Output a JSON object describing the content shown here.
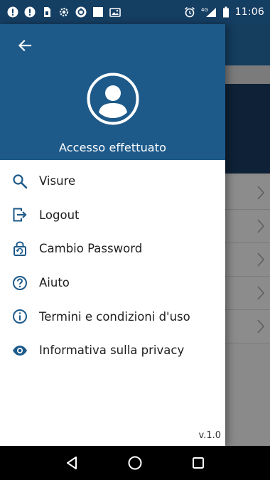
{
  "status_bar": {
    "network_label": "4G",
    "time": "11:06",
    "icons": [
      "alert-icon",
      "alert-icon",
      "sim-icon",
      "settings-icon",
      "sync-icon",
      "app-icon",
      "photo-icon",
      "alarm-icon",
      "signal-icon",
      "battery-icon"
    ]
  },
  "drawer": {
    "back_icon": "arrow-left-icon",
    "avatar_icon": "account-circle-icon",
    "status": "Accesso effettuato",
    "items": [
      {
        "label": "Visure",
        "icon": "search-icon"
      },
      {
        "label": "Logout",
        "icon": "logout-icon"
      },
      {
        "label": "Cambio Password",
        "icon": "lock-icon"
      },
      {
        "label": "Aiuto",
        "icon": "help-icon"
      },
      {
        "label": "Termini e condizioni d'uso",
        "icon": "info-icon"
      },
      {
        "label": "Informativa sulla privacy",
        "icon": "eye-icon"
      }
    ],
    "version": "v.1.0"
  },
  "navigation": {
    "buttons": [
      "back-triangle-icon",
      "home-circle-icon",
      "recents-square-icon"
    ]
  },
  "colors": {
    "header_blue": "#1d5a8a",
    "status_bar_blue": "#153e63",
    "icon_blue": "#1d5a8a",
    "nav_bar": "#000000"
  }
}
